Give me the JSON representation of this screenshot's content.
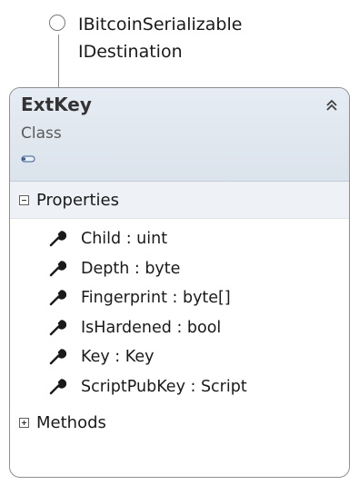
{
  "interfaces": [
    "IBitcoinSerializable",
    "IDestination"
  ],
  "class": {
    "name": "ExtKey",
    "kind": "Class"
  },
  "sections": {
    "properties": {
      "label": "Properties",
      "items": [
        "Child : uint",
        "Depth : byte",
        "Fingerprint : byte[]",
        "IsHardened : bool",
        "Key : Key",
        "ScriptPubKey : Script"
      ]
    },
    "methods": {
      "label": "Methods"
    }
  },
  "icons": {
    "lollipop": "interface-lollipop-icon",
    "collapse": "double-chevron-up-icon",
    "toggle": "toggle-visibility-icon",
    "property": "wrench-icon",
    "expanded": "minus-box-icon",
    "collapsed": "plus-box-icon"
  },
  "colors": {
    "header_bg": "#dbe3ec",
    "border": "#8f8f8f",
    "icon": "#1a1a1a"
  }
}
